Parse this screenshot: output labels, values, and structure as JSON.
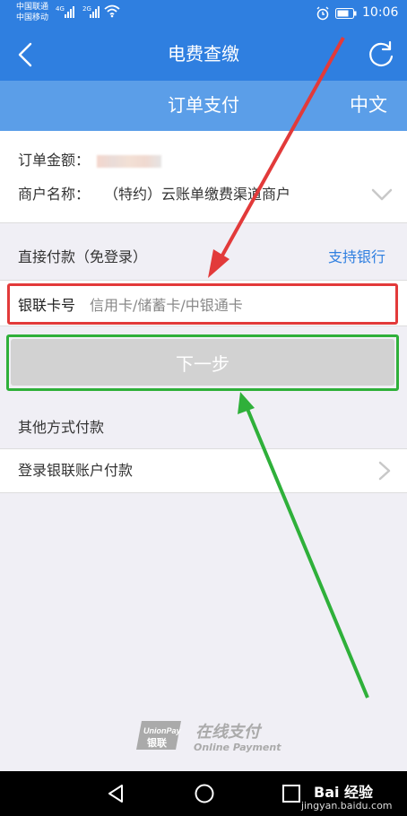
{
  "status_bar": {
    "carrier1": "中国联通",
    "carrier2": "中国移动",
    "signal1_type": "4G",
    "signal2_type": "2G",
    "time": "10:06"
  },
  "header": {
    "title": "电费查缴"
  },
  "subheader": {
    "title": "订单支付",
    "language": "中文"
  },
  "order": {
    "amount_label": "订单金额：",
    "merchant_label": "商户名称：",
    "merchant_name": "（特约）云账单缴费渠道商户"
  },
  "direct_pay": {
    "label": "直接付款（免登录）",
    "support_bank": "支持银行",
    "card_label": "银联卡号",
    "card_placeholder": "信用卡/储蓄卡/中银通卡",
    "card_value": "",
    "next_button": "下一步"
  },
  "other": {
    "label": "其他方式付款",
    "login_option": "登录银联账户付款"
  },
  "footer": {
    "logo_text": "UnionPay 银联",
    "online_cn": "在线支付",
    "online_en": "Online Payment"
  },
  "watermark": {
    "cn": "Bai 经验",
    "en": "jingyan.baidu.com"
  },
  "colors": {
    "primary": "#2f7fe0",
    "subheader": "#5b9ee8",
    "annotation_red": "#e23a3a",
    "annotation_green": "#2fb03a",
    "button_disabled": "#d2d2d2"
  },
  "icons": [
    "back-arrow-icon",
    "refresh-icon",
    "chevron-down-icon",
    "chevron-right-icon",
    "alarm-icon",
    "battery-icon",
    "wifi-icon"
  ]
}
